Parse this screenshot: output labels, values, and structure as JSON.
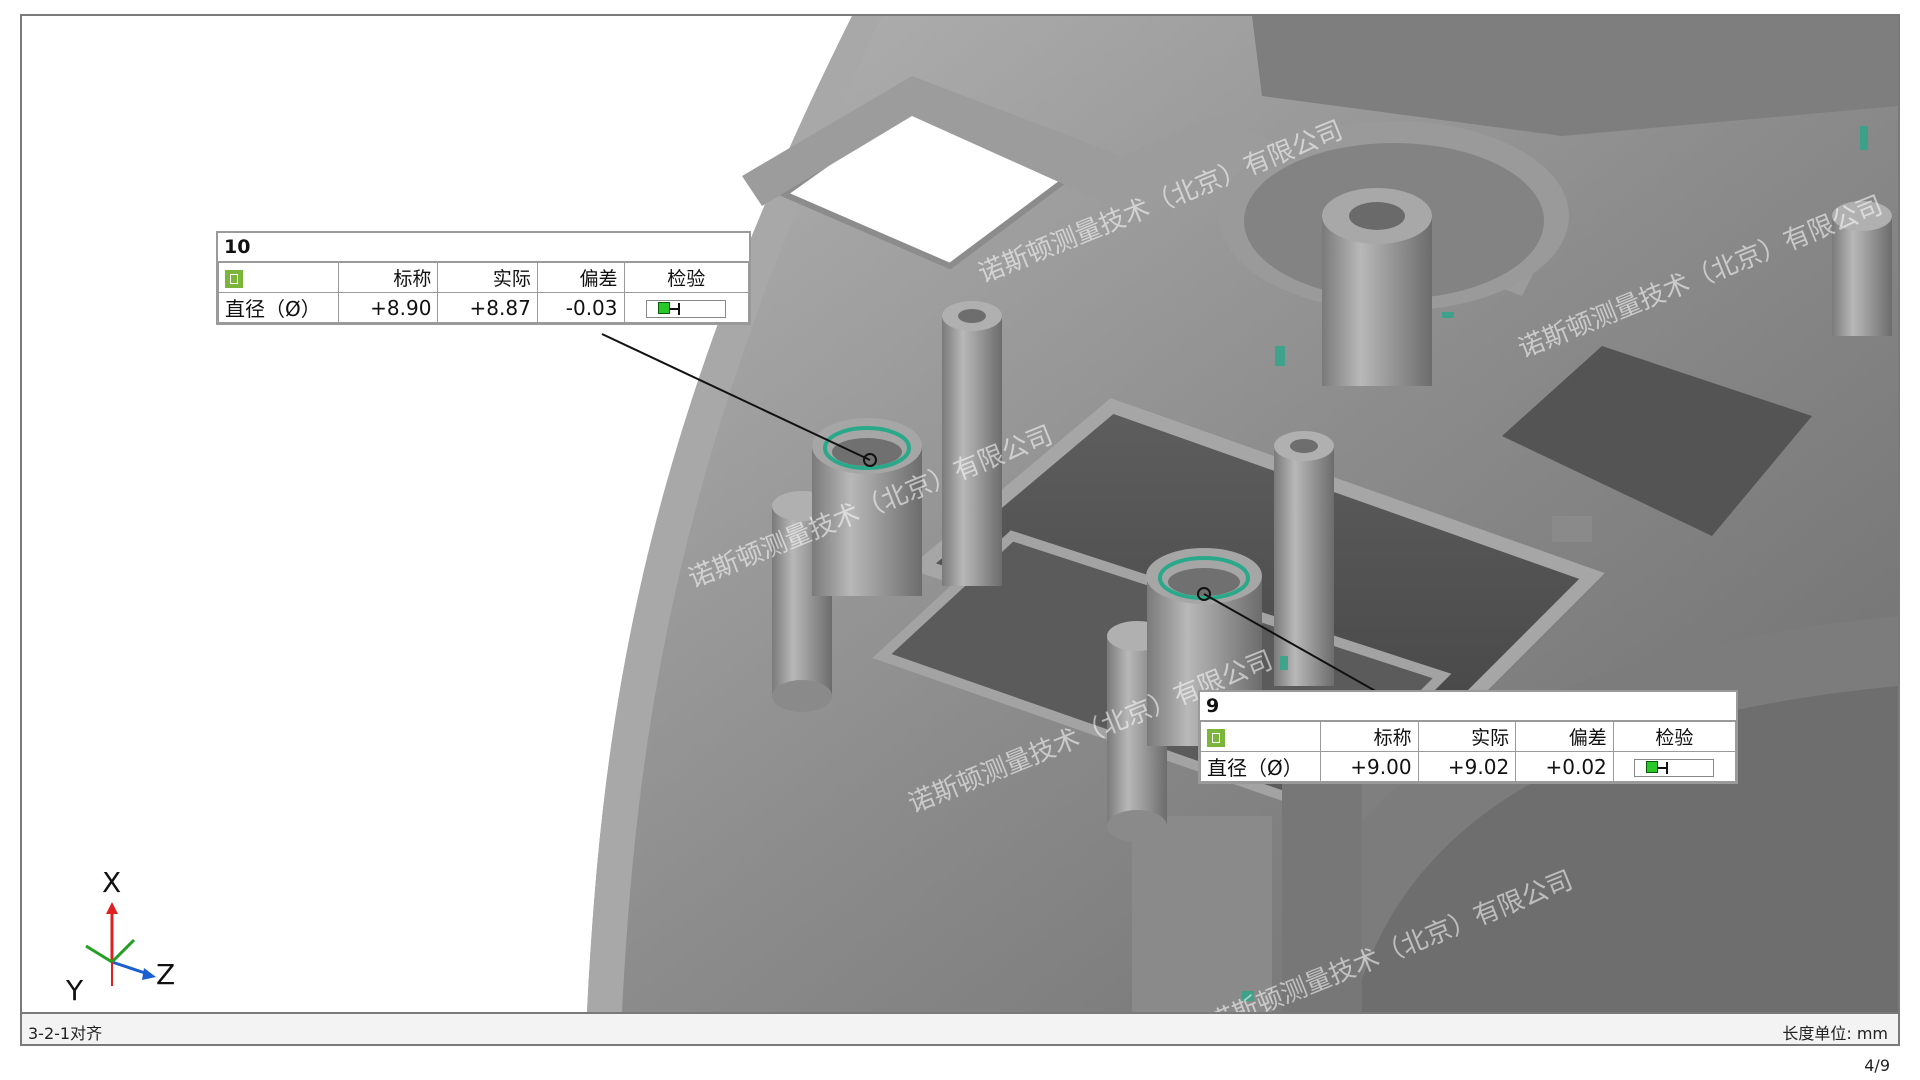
{
  "callouts": [
    {
      "id": "10",
      "headers": [
        "标称",
        "实际",
        "偏差",
        "检验"
      ],
      "row": {
        "label": "直径（Ø）",
        "nominal": "+8.90",
        "actual": "+8.87",
        "deviation": "-0.03"
      },
      "gauge_level": 0.25,
      "status": "pass"
    },
    {
      "id": "9",
      "headers": [
        "标称",
        "实际",
        "偏差",
        "检验"
      ],
      "row": {
        "label": "直径（Ø）",
        "nominal": "+9.00",
        "actual": "+9.02",
        "deviation": "+0.02"
      },
      "gauge_level": 0.25,
      "status": "pass"
    }
  ],
  "axes": {
    "x": "X",
    "y": "Y",
    "z": "Z"
  },
  "status_bar": {
    "left": "3-2-1对齐",
    "right": "长度单位: mm"
  },
  "page": "4/9",
  "watermark": "诺斯顿测量技术（北京）有限公司",
  "colors": {
    "model": "#8e8e8e",
    "deviation_highlight": "#2aa88a",
    "pass": "#28c828"
  }
}
